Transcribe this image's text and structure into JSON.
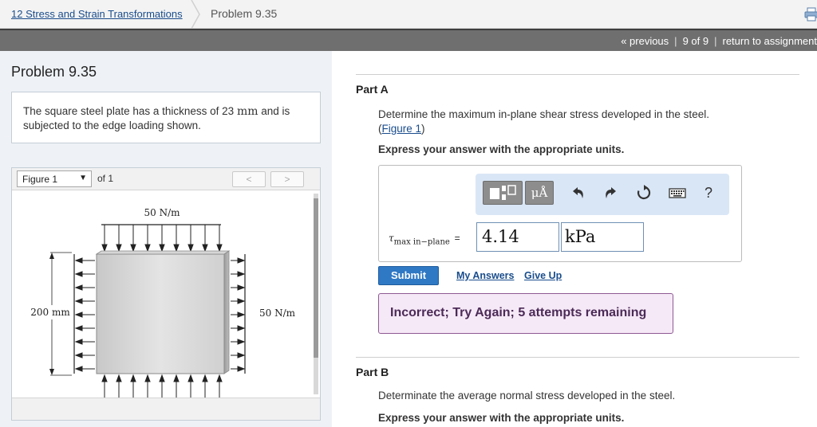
{
  "breadcrumb": {
    "chapter": "12 Stress and Strain Transformations",
    "problem": "Problem 9.35"
  },
  "nav": {
    "previous": "« previous",
    "position": "9 of 9",
    "return": "return to assignment"
  },
  "left": {
    "title": "Problem 9.35",
    "statement_pre": "The square steel plate has a thickness of 23",
    "statement_unit": "mm",
    "statement_post": "and is subjected to the edge loading shown.",
    "figure_select": "Figure 1",
    "figure_of": "of 1",
    "prev_btn": "<",
    "next_btn": ">"
  },
  "figure": {
    "top_load": "50 N/m",
    "side_load": "50 N/m",
    "dimension": "200 mm"
  },
  "partA": {
    "title": "Part A",
    "question": "Determine the maximum in-plane shear stress developed in the steel.",
    "figure_link": "Figure 1",
    "units_instruction": "Express your answer with the appropriate units.",
    "toolbar": {
      "mu_label": "μÅ",
      "help": "?"
    },
    "symbol": "τ",
    "subscript": "max in−plane",
    "equals": "=",
    "value": "4.14",
    "unit": "kPa",
    "submit": "Submit",
    "my_answers": "My Answers",
    "give_up": "Give Up",
    "feedback": "Incorrect; Try Again; 5 attempts remaining"
  },
  "partB": {
    "title": "Part B",
    "question": "Determinate the average normal stress developed in the steel.",
    "units_instruction": "Express your answer with the appropriate units."
  },
  "colors": {
    "accent": "#2f78c4",
    "feedback_bg": "#f6e9f7",
    "feedback_border": "#8d5a93",
    "toolbar_bg": "#d9e6f6"
  },
  "icons": [
    "print-icon",
    "template-icon",
    "undo-icon",
    "redo-icon",
    "reset-icon",
    "keyboard-icon"
  ]
}
